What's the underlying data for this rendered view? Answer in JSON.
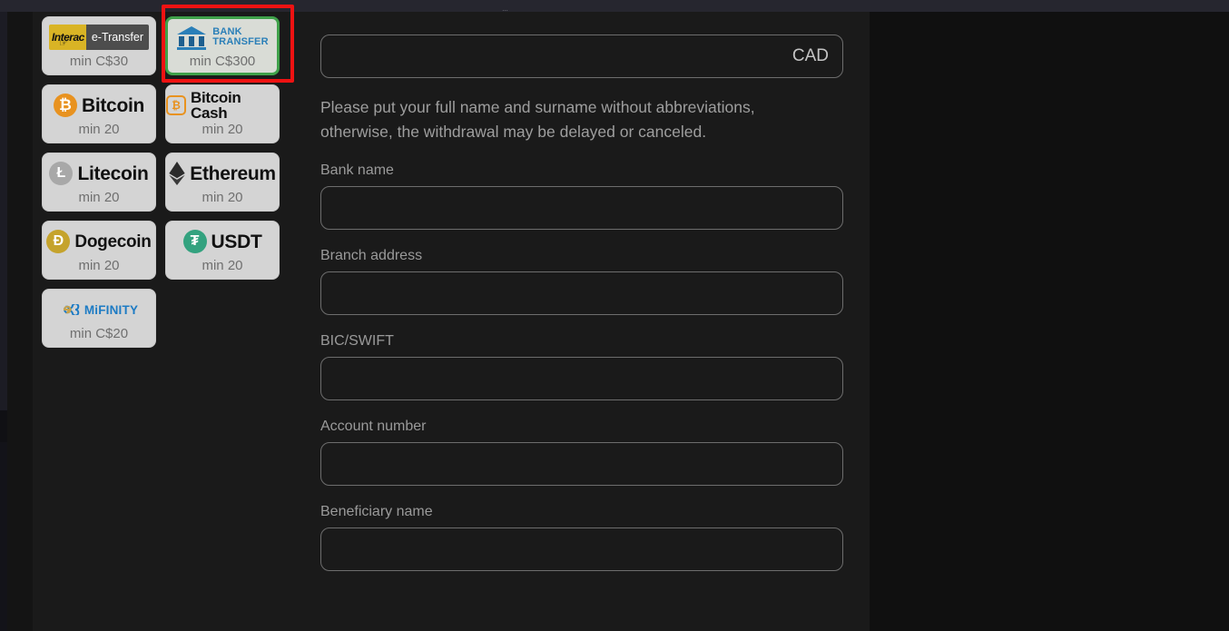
{
  "window": {
    "top_strip_fragment": "…"
  },
  "payment_methods": {
    "rows": [
      [
        {
          "id": "interac-etransfer",
          "logo": "interac-etransfer-logo",
          "brand_primary": "Interac",
          "brand_secondary": "e-Transfer",
          "min_label": "min C$30",
          "selected": false
        },
        {
          "id": "bank-transfer",
          "logo": "bank-transfer-logo",
          "brand_line1": "BANK",
          "brand_line2": "TRANSFER",
          "min_label": "min C$300",
          "selected": true
        }
      ],
      [
        {
          "id": "bitcoin",
          "logo": "bitcoin-icon",
          "symbol": "₿",
          "name": "Bitcoin",
          "min_label": "min 20",
          "selected": false
        },
        {
          "id": "bitcoin-cash",
          "logo": "bitcoin-cash-icon",
          "symbol": "₿",
          "name": "Bitcoin Cash",
          "min_label": "min 20",
          "selected": false
        }
      ],
      [
        {
          "id": "litecoin",
          "logo": "litecoin-icon",
          "symbol": "Ł",
          "name": "Litecoin",
          "min_label": "min 20",
          "selected": false
        },
        {
          "id": "ethereum",
          "logo": "ethereum-icon",
          "symbol": "",
          "name": "Ethereum",
          "min_label": "min 20",
          "selected": false
        }
      ],
      [
        {
          "id": "dogecoin",
          "logo": "dogecoin-icon",
          "symbol": "Ð",
          "name": "Dogecoin",
          "min_label": "min 20",
          "selected": false
        },
        {
          "id": "usdt",
          "logo": "usdt-icon",
          "symbol": "₮",
          "name": "USDT",
          "min_label": "min 20",
          "selected": false
        }
      ],
      [
        {
          "id": "mifinity",
          "logo": "mifinity-logo",
          "brand_primary": "MiFINITY",
          "min_label": "min C$20",
          "selected": false
        }
      ]
    ],
    "selected_id": "bank-transfer",
    "selected_border_color": "#3fa14a",
    "annotation_color": "#ef1212"
  },
  "form": {
    "amount": {
      "value": "",
      "placeholder": "",
      "currency": "CAD"
    },
    "note": "Please put your full name and surname without abbreviations, otherwise, the withdrawal may be delayed or canceled.",
    "fields": [
      {
        "id": "bank-name",
        "label": "Bank name",
        "value": "",
        "placeholder": ""
      },
      {
        "id": "branch-address",
        "label": "Branch address",
        "value": "",
        "placeholder": ""
      },
      {
        "id": "bic-swift",
        "label": "BIC/SWIFT",
        "value": "",
        "placeholder": ""
      },
      {
        "id": "account-number",
        "label": "Account number",
        "value": "",
        "placeholder": ""
      },
      {
        "id": "beneficiary-name",
        "label": "Beneficiary name",
        "value": "",
        "placeholder": ""
      }
    ]
  },
  "colors": {
    "page_background": "#101010",
    "panel_background": "#1a1a1a",
    "top_strip": "#26262f",
    "card_background": "#d4d4d4",
    "input_border": "#6d6d6d",
    "label_text": "#9a9a9a",
    "bank_blue": "#2a7fb8",
    "mifinity_blue": "#1d7bc4"
  }
}
